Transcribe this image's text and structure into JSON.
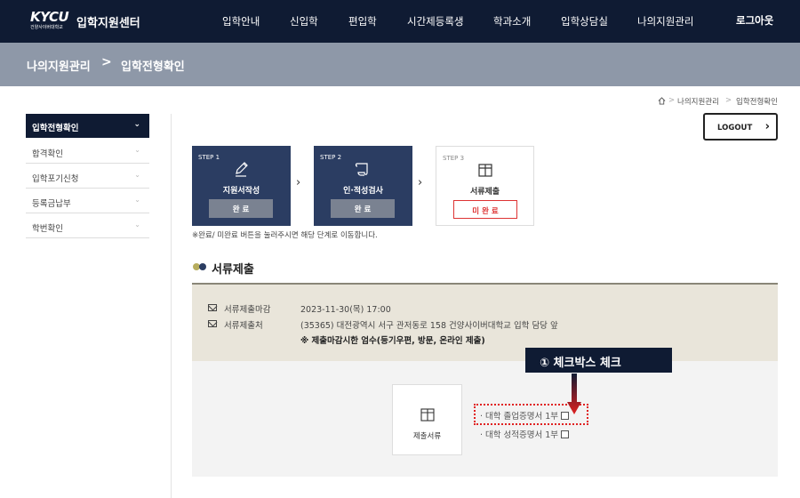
{
  "header": {
    "logo_text": "KYCU",
    "logo_sub": "건양사이버대학교",
    "site_title": "입학지원센터",
    "menu": [
      "입학안내",
      "신입학",
      "편입학",
      "시간제등록생",
      "학과소개",
      "입학상담실",
      "나의지원관리"
    ],
    "logout": "로그아웃"
  },
  "banner": {
    "parent": "나의지원관리",
    "separator": ">",
    "current": "입학전형확인"
  },
  "breadcrumb": {
    "home_icon": "home-icon",
    "items": [
      "나의지원관리",
      "입학전형확인"
    ],
    "separator": ">"
  },
  "sidebar": {
    "active": "입학전형확인",
    "items": [
      "합격확인",
      "입학포기신청",
      "등록금납부",
      "학번확인"
    ]
  },
  "logout_button": "LOGOUT",
  "steps": [
    {
      "label": "STEP 1",
      "name": "지원서작성",
      "status": "완 료",
      "icon": "pencil-icon"
    },
    {
      "label": "STEP 2",
      "name": "인·적성검사",
      "status": "완 료",
      "icon": "scroll-icon"
    },
    {
      "label": "STEP 3",
      "name": "서류제출",
      "status": "미 완 료",
      "icon": "box-icon"
    }
  ],
  "step_note": "※완료/ 미완료 버튼을 눌러주시면 해당 단계로 이동합니다.",
  "section": {
    "title": "서류제출",
    "dot_colors": [
      "#b7ad5e",
      "#2b3d62"
    ]
  },
  "info": {
    "deadline_label": "서류제출마감",
    "deadline_value": "2023-11-30(목) 17:00",
    "address_label": "서류제출처",
    "address_value": "(35365) 대전광역시 서구 관저동로 158 건양사이버대학교 입학 담당 앞",
    "notice": "※ 제출마감시한 엄수(등기우편, 방문, 온라인 제출)"
  },
  "submission": {
    "box_label": "제출서류",
    "documents": [
      "· 대학 졸업증명서 1부",
      "· 대학 성적증명서 1부"
    ]
  },
  "callout": "① 체크박스 체크",
  "colors": {
    "navy": "#0f1b33",
    "banner": "#8e98a8",
    "step_dark": "#2b3d62",
    "highlight_red": "#e02020",
    "incomplete_red": "#d33333"
  }
}
